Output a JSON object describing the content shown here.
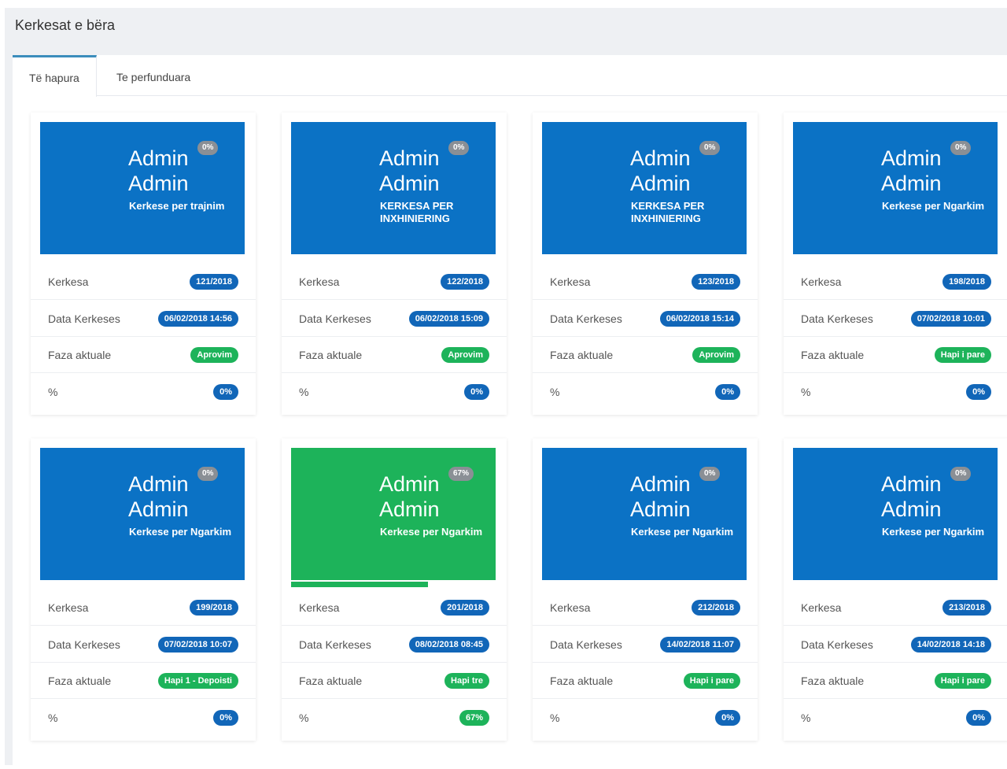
{
  "header": {
    "title": "Kerkesat e bëra"
  },
  "tabs": [
    {
      "label": "Të hapura",
      "active": true
    },
    {
      "label": "Te perfunduara",
      "active": false
    }
  ],
  "labels": {
    "kerkesa": "Kerkesa",
    "data": "Data Kerkeses",
    "faza": "Faza aktuale",
    "percent": "%"
  },
  "colors": {
    "card_blue": "#0b72c5",
    "card_green": "#1db35a",
    "badge_blue": "#1166b8",
    "badge_green": "#1db35a",
    "tab_accent": "#3c8dbc"
  },
  "cards": [
    {
      "first": "Admin",
      "last": "Admin",
      "subtitle": "Kerkese per trajnim",
      "badge": "0%",
      "kerkesa": "121/2018",
      "data": "06/02/2018 14:56",
      "faza": "Aprovim",
      "percent": "0%",
      "progress": 0,
      "color": "blue"
    },
    {
      "first": "Admin",
      "last": "Admin",
      "subtitle": "KERKESA PER INXHINIERING",
      "badge": "0%",
      "kerkesa": "122/2018",
      "data": "06/02/2018 15:09",
      "faza": "Aprovim",
      "percent": "0%",
      "progress": 0,
      "color": "blue"
    },
    {
      "first": "Admin",
      "last": "Admin",
      "subtitle": "KERKESA PER INXHINIERING",
      "badge": "0%",
      "kerkesa": "123/2018",
      "data": "06/02/2018 15:14",
      "faza": "Aprovim",
      "percent": "0%",
      "progress": 0,
      "color": "blue"
    },
    {
      "first": "Admin",
      "last": "Admin",
      "subtitle": "Kerkese per Ngarkim",
      "badge": "0%",
      "kerkesa": "198/2018",
      "data": "07/02/2018 10:01",
      "faza": "Hapi i pare",
      "percent": "0%",
      "progress": 0,
      "color": "blue"
    },
    {
      "first": "Admin",
      "last": "Admin",
      "subtitle": "Kerkese per Ngarkim",
      "badge": "0%",
      "kerkesa": "199/2018",
      "data": "07/02/2018 10:07",
      "faza": "Hapi 1 - Depoisti",
      "percent": "0%",
      "progress": 0,
      "color": "blue"
    },
    {
      "first": "Admin",
      "last": "Admin",
      "subtitle": "Kerkese per Ngarkim",
      "badge": "67%",
      "kerkesa": "201/2018",
      "data": "08/02/2018 08:45",
      "faza": "Hapi tre",
      "percent": "67%",
      "progress": 0.67,
      "color": "green"
    },
    {
      "first": "Admin",
      "last": "Admin",
      "subtitle": "Kerkese per Ngarkim",
      "badge": "0%",
      "kerkesa": "212/2018",
      "data": "14/02/2018 11:07",
      "faza": "Hapi i pare",
      "percent": "0%",
      "progress": 0,
      "color": "blue"
    },
    {
      "first": "Admin",
      "last": "Admin",
      "subtitle": "Kerkese per Ngarkim",
      "badge": "0%",
      "kerkesa": "213/2018",
      "data": "14/02/2018 14:18",
      "faza": "Hapi i pare",
      "percent": "0%",
      "progress": 0,
      "color": "blue"
    }
  ]
}
